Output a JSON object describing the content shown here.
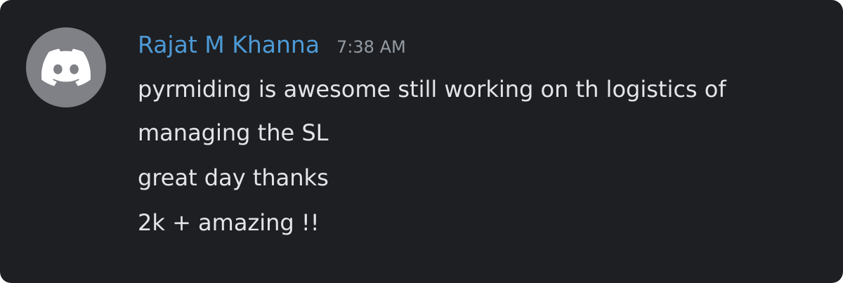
{
  "message_group": {
    "author": "Rajat M Khanna",
    "timestamp": "7:38 AM",
    "avatar_icon": "discord-logo-icon",
    "avatar_bg": "#7f8187",
    "name_color": "#4d9ad6",
    "messages": [
      {
        "text": "pyrmiding is awesome still working on th logistics of managing the SL"
      },
      {
        "text": "great day thanks"
      },
      {
        "text": "2k + amazing !!"
      }
    ]
  }
}
